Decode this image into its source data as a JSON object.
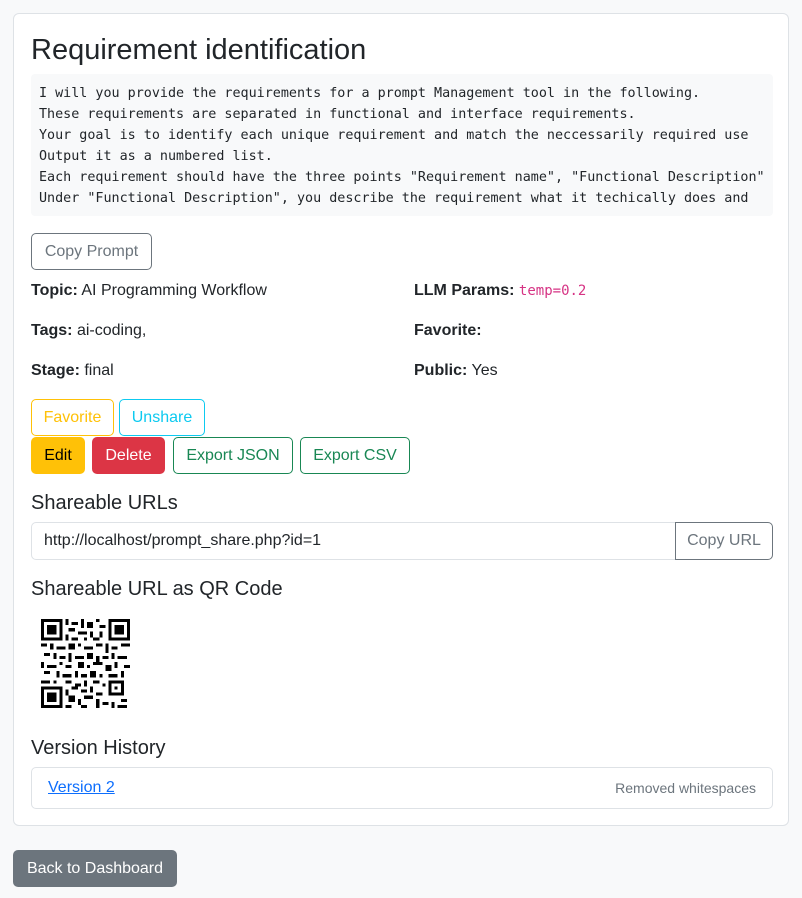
{
  "title": "Requirement identification",
  "prompt_lines": [
    "I will you provide the requirements for a prompt Management tool in the following.",
    "These requirements are separated in functional and interface requirements.",
    "Your goal is to identify each unique requirement and match the neccessarily required use",
    "Output it as a numbered list.",
    "Each requirement should have the three points \"Requirement name\", \"Functional Description\"",
    "Under \"Functional Description\", you describe the requirement what it techically does and"
  ],
  "buttons": {
    "copy_prompt": "Copy Prompt",
    "favorite": "Favorite",
    "unshare": "Unshare",
    "edit": "Edit",
    "delete": "Delete",
    "export_json": "Export JSON",
    "export_csv": "Export CSV",
    "copy_url": "Copy URL",
    "back": "Back to Dashboard"
  },
  "meta": {
    "topic_label": "Topic:",
    "topic_value": "AI Programming Workflow",
    "llm_label": "LLM Params:",
    "llm_value": "temp=0.2",
    "tags_label": "Tags:",
    "tags_value": "ai-coding,",
    "favorite_label": "Favorite:",
    "favorite_value": "",
    "stage_label": "Stage:",
    "stage_value": "final",
    "public_label": "Public:",
    "public_value": "Yes"
  },
  "share": {
    "heading": "Shareable URLs",
    "url": "http://localhost/prompt_share.php?id=1",
    "qr_heading": "Shareable URL as QR Code"
  },
  "versions": {
    "heading": "Version History",
    "items": [
      {
        "label": "Version 2",
        "note": "Removed whitespaces"
      }
    ]
  },
  "colors": {
    "primary": "#0d6efd",
    "warning": "#ffc107",
    "danger": "#dc3545",
    "info": "#0dcaf0",
    "success": "#198754",
    "secondary": "#6c757d",
    "code": "#d63384"
  }
}
